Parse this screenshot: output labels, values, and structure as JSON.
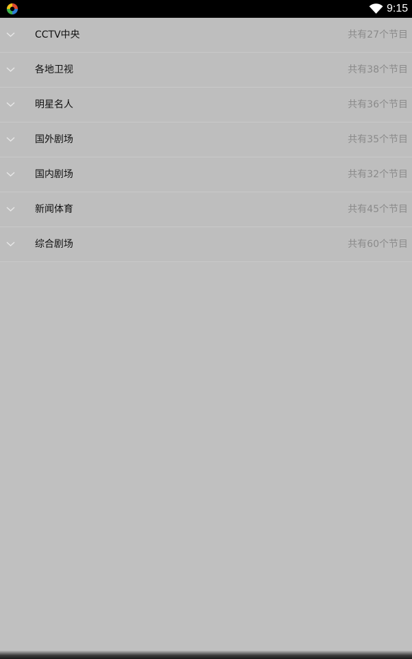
{
  "status_bar": {
    "time": "9:15",
    "app_icon": "app-logo-icon",
    "wifi_icon": "wifi-icon"
  },
  "categories": [
    {
      "title": "CCTV中央",
      "count_text": "共有27个节目"
    },
    {
      "title": "各地卫视",
      "count_text": "共有38个节目"
    },
    {
      "title": "明星名人",
      "count_text": "共有36个节目"
    },
    {
      "title": "国外剧场",
      "count_text": "共有35个节目"
    },
    {
      "title": "国内剧场",
      "count_text": "共有32个节目"
    },
    {
      "title": "新闻体育",
      "count_text": "共有45个节目"
    },
    {
      "title": "综合剧场",
      "count_text": "共有60个节目"
    }
  ],
  "colors": {
    "background": "#c0c0c0",
    "status_bar": "#000000",
    "title_text": "#111111",
    "count_text": "#8a8a8a"
  }
}
